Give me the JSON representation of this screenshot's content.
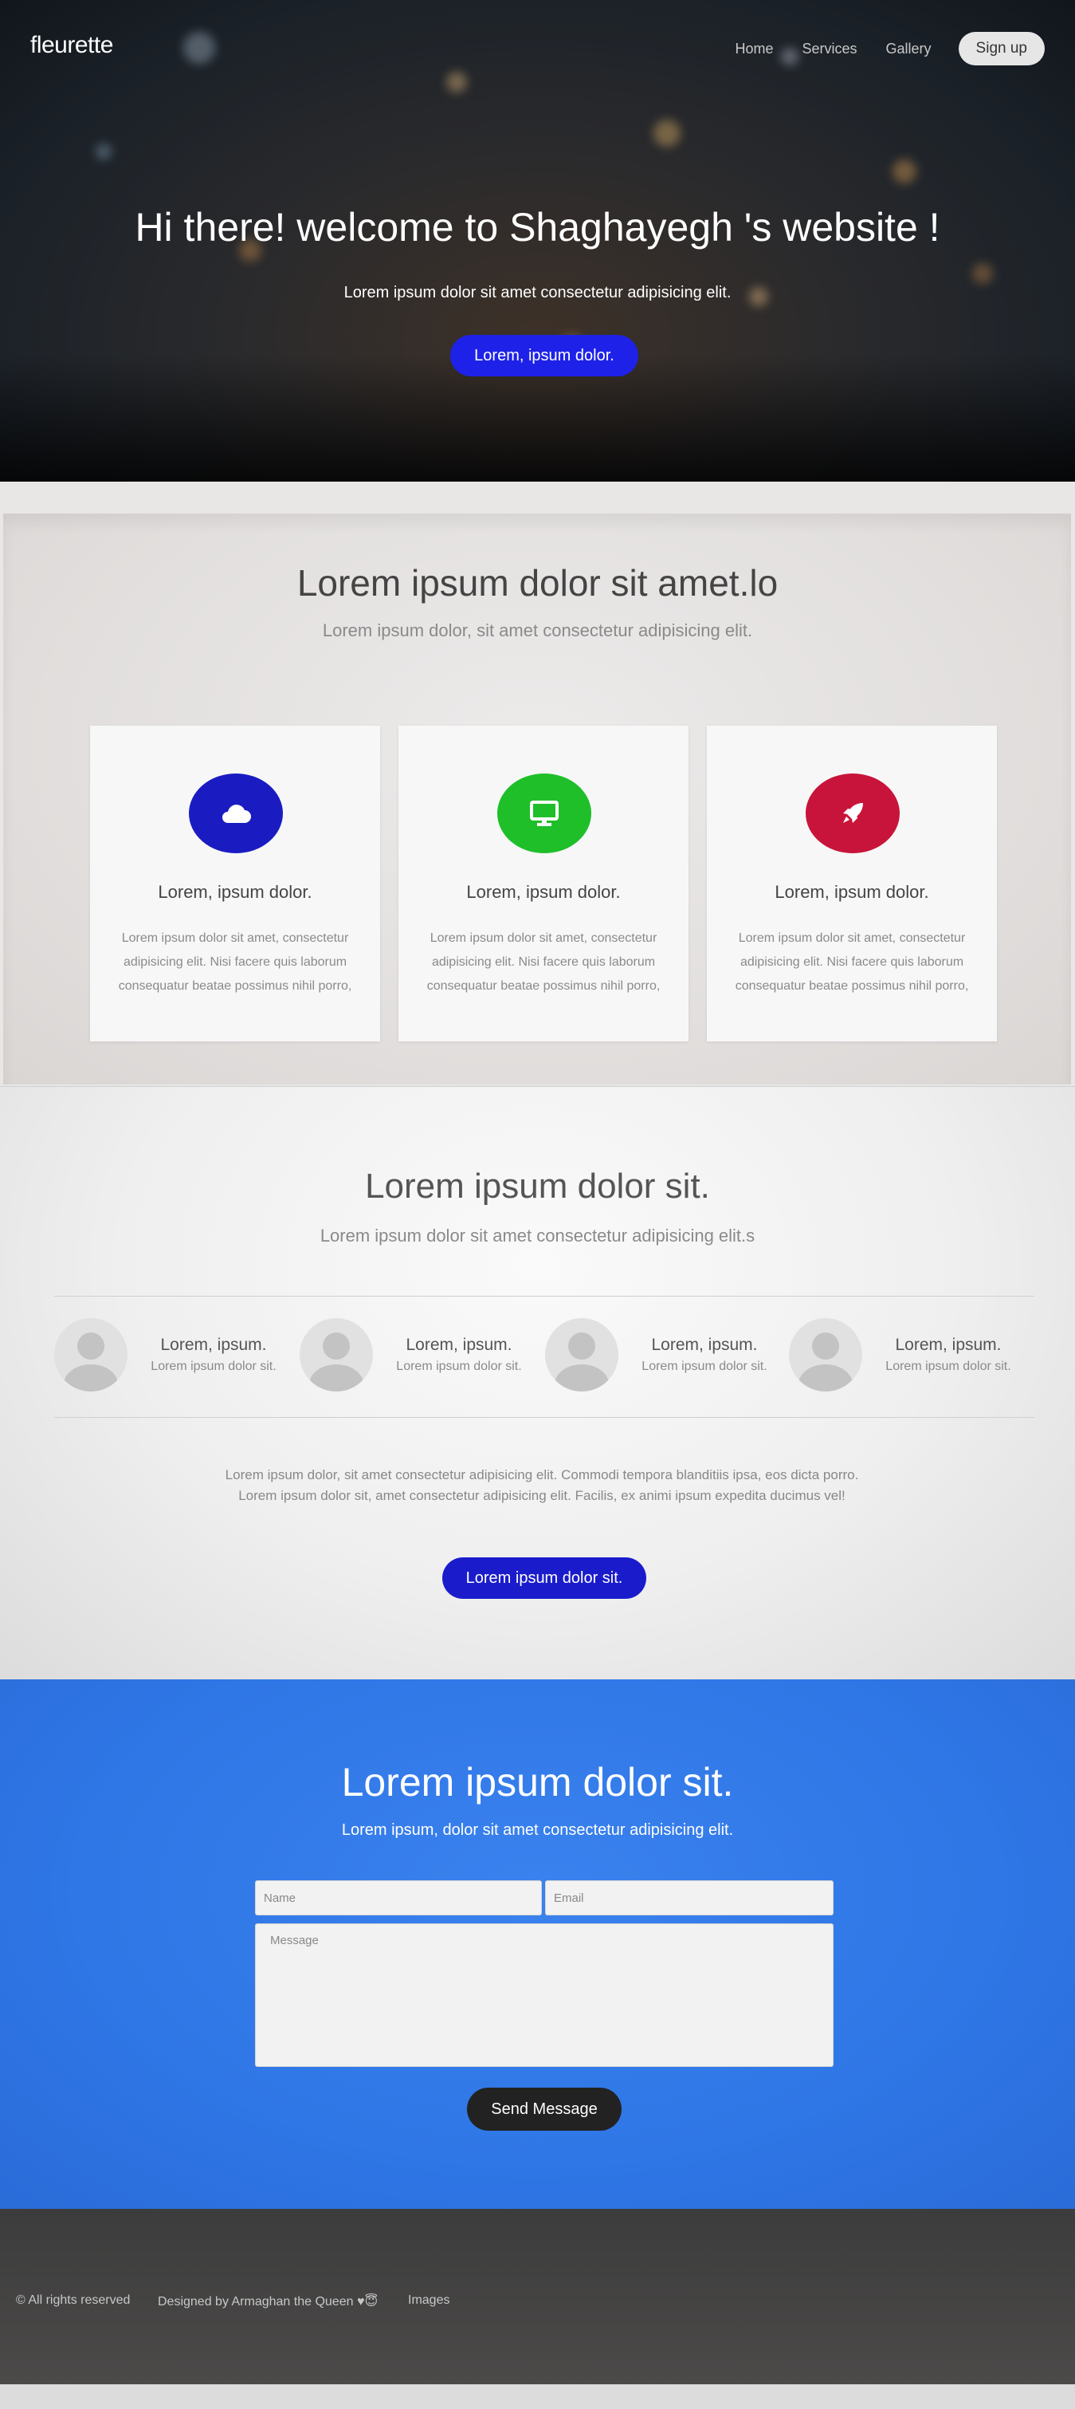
{
  "header": {
    "brand": "fleurette",
    "nav": [
      "Home",
      "Services",
      "Gallery"
    ],
    "signup_label": "Sign up"
  },
  "hero": {
    "title": "Hi there! welcome to Shaghayegh 's website !",
    "subtitle": "Lorem ipsum dolor sit amet consectetur adipisicing elit.",
    "cta_label": "Lorem, ipsum dolor."
  },
  "features": {
    "title": "Lorem ipsum dolor sit amet.lo",
    "subtitle": "Lorem ipsum dolor, sit amet consectetur adipisicing elit.",
    "cards": [
      {
        "icon": "cloud-icon",
        "color": "#1a1cc2",
        "title": "Lorem, ipsum dolor.",
        "text": "Lorem ipsum dolor sit amet, consectetur adipisicing elit. Nisi facere quis laborum consequatur beatae possimus nihil porro,"
      },
      {
        "icon": "monitor-icon",
        "color": "#1fbf2a",
        "title": "Lorem, ipsum dolor.",
        "text": "Lorem ipsum dolor sit amet, consectetur adipisicing elit. Nisi facere quis laborum consequatur beatae possimus nihil porro,"
      },
      {
        "icon": "rocket-icon",
        "color": "#c8143a",
        "title": "Lorem, ipsum dolor.",
        "text": "Lorem ipsum dolor sit amet, consectetur adipisicing elit. Nisi facere quis laborum consequatur beatae possimus nihil porro,"
      }
    ]
  },
  "team": {
    "title": "Lorem ipsum dolor sit.",
    "subtitle": "Lorem ipsum dolor sit amet consectetur adipisicing elit.s",
    "members": [
      {
        "name": "Lorem, ipsum.",
        "role": "Lorem ipsum dolor sit."
      },
      {
        "name": "Lorem, ipsum.",
        "role": "Lorem ipsum dolor sit."
      },
      {
        "name": "Lorem, ipsum.",
        "role": "Lorem ipsum dolor sit."
      },
      {
        "name": "Lorem, ipsum.",
        "role": "Lorem ipsum dolor sit."
      }
    ],
    "paragraph": "Lorem ipsum dolor, sit amet consectetur adipisicing elit. Commodi tempora blanditiis ipsa, eos dicta porro. Lorem ipsum dolor sit, amet consectetur adipisicing elit. Facilis, ex animi ipsum expedita ducimus vel!",
    "cta_label": "Lorem ipsum dolor sit."
  },
  "contact": {
    "title": "Lorem ipsum dolor sit.",
    "subtitle": "Lorem ipsum, dolor sit amet consectetur adipisicing elit.",
    "name_placeholder": "Name",
    "email_placeholder": "Email",
    "message_placeholder": "Message",
    "send_label": "Send Message"
  },
  "footer": {
    "copyright": "© All rights reserved",
    "credit": "Designed by Armaghan the Queen ♥😇",
    "images_link": "Images"
  }
}
